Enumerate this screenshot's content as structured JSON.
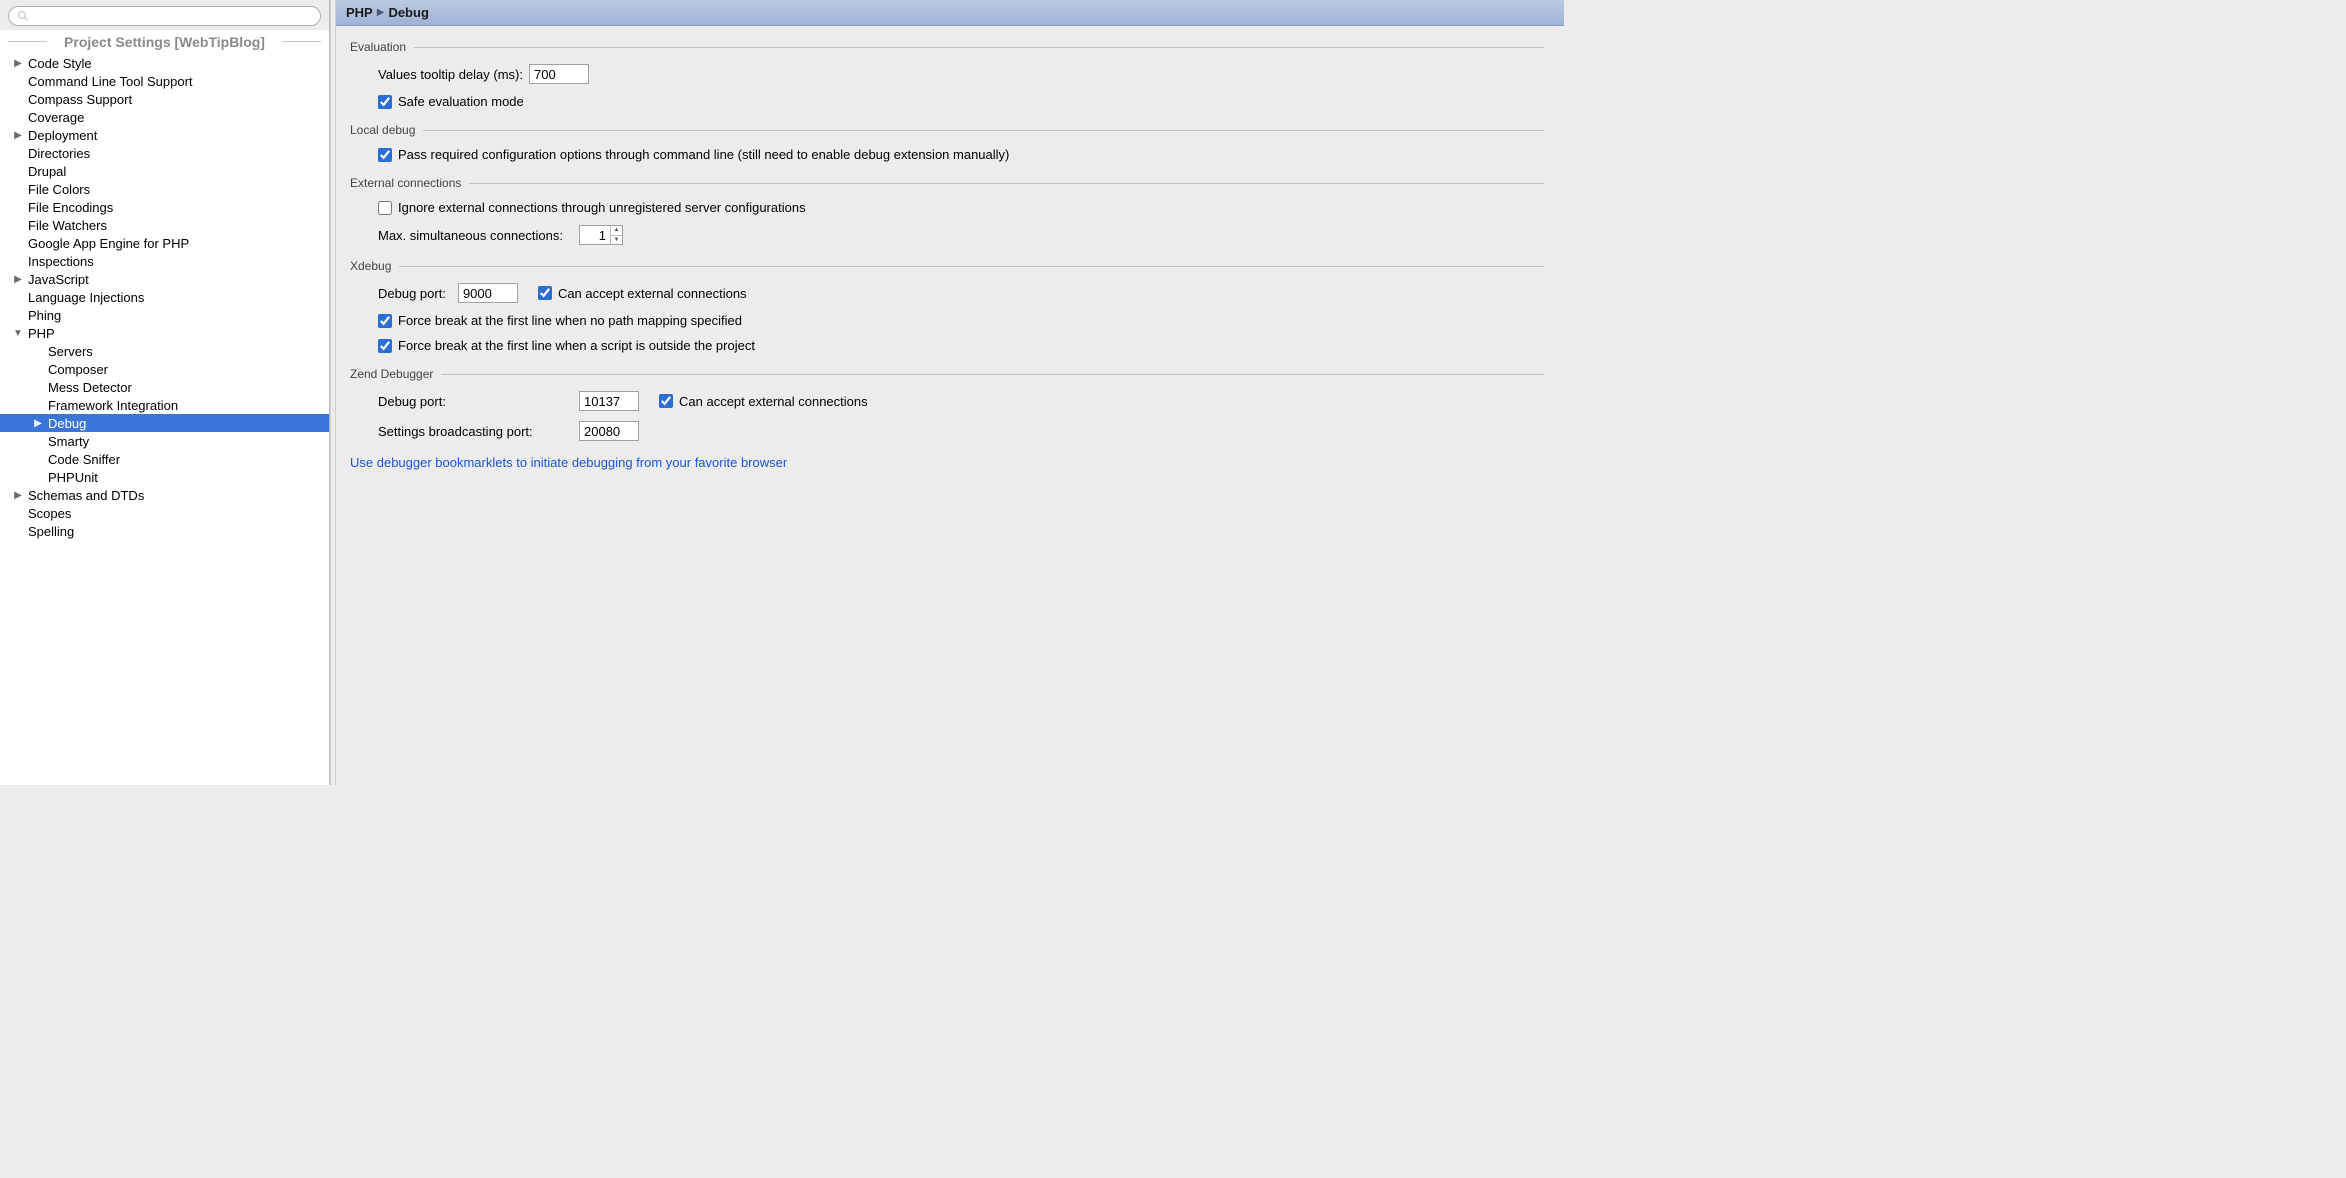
{
  "sidebar": {
    "sectionTitle": "Project Settings [WebTipBlog]",
    "searchPlaceholder": "",
    "items": [
      {
        "label": "Code Style",
        "arrow": "right",
        "level": 1
      },
      {
        "label": "Command Line Tool Support",
        "arrow": "none",
        "level": 1
      },
      {
        "label": "Compass Support",
        "arrow": "none",
        "level": 1
      },
      {
        "label": "Coverage",
        "arrow": "none",
        "level": 1
      },
      {
        "label": "Deployment",
        "arrow": "right",
        "level": 1
      },
      {
        "label": "Directories",
        "arrow": "none",
        "level": 1
      },
      {
        "label": "Drupal",
        "arrow": "none",
        "level": 1
      },
      {
        "label": "File Colors",
        "arrow": "none",
        "level": 1
      },
      {
        "label": "File Encodings",
        "arrow": "none",
        "level": 1
      },
      {
        "label": "File Watchers",
        "arrow": "none",
        "level": 1
      },
      {
        "label": "Google App Engine for PHP",
        "arrow": "none",
        "level": 1
      },
      {
        "label": "Inspections",
        "arrow": "none",
        "level": 1
      },
      {
        "label": "JavaScript",
        "arrow": "right",
        "level": 1
      },
      {
        "label": "Language Injections",
        "arrow": "none",
        "level": 1
      },
      {
        "label": "Phing",
        "arrow": "none",
        "level": 1
      },
      {
        "label": "PHP",
        "arrow": "down",
        "level": 1
      },
      {
        "label": "Servers",
        "arrow": "none",
        "level": 2
      },
      {
        "label": "Composer",
        "arrow": "none",
        "level": 2
      },
      {
        "label": "Mess Detector",
        "arrow": "none",
        "level": 2
      },
      {
        "label": "Framework Integration",
        "arrow": "none",
        "level": 2
      },
      {
        "label": "Debug",
        "arrow": "right",
        "level": 2,
        "selected": true
      },
      {
        "label": "Smarty",
        "arrow": "none",
        "level": 2
      },
      {
        "label": "Code Sniffer",
        "arrow": "none",
        "level": 2
      },
      {
        "label": "PHPUnit",
        "arrow": "none",
        "level": 2
      },
      {
        "label": "Schemas and DTDs",
        "arrow": "right",
        "level": 1
      },
      {
        "label": "Scopes",
        "arrow": "none",
        "level": 1
      },
      {
        "label": "Spelling",
        "arrow": "none",
        "level": 1
      }
    ]
  },
  "breadcrumb": {
    "root": "PHP",
    "current": "Debug"
  },
  "groups": {
    "evaluation": {
      "title": "Evaluation",
      "tooltipDelayLabel": "Values tooltip delay (ms):",
      "tooltipDelayValue": "700",
      "safeEvalLabel": "Safe evaluation mode",
      "safeEvalChecked": true
    },
    "localDebug": {
      "title": "Local debug",
      "passConfigLabel": "Pass required configuration options through command line (still need to enable debug extension manually)",
      "passConfigChecked": true
    },
    "externalConn": {
      "title": "External connections",
      "ignoreLabel": "Ignore external connections through unregistered server configurations",
      "ignoreChecked": false,
      "maxConnLabel": "Max. simultaneous connections:",
      "maxConnValue": "1"
    },
    "xdebug": {
      "title": "Xdebug",
      "portLabel": "Debug port:",
      "portValue": "9000",
      "acceptExtLabel": "Can accept external connections",
      "acceptExtChecked": true,
      "forceBreakNoPathLabel": "Force break at the first line when no path mapping specified",
      "forceBreakNoPathChecked": true,
      "forceBreakOutsideLabel": "Force break at the first line when a script is outside the project",
      "forceBreakOutsideChecked": true
    },
    "zend": {
      "title": "Zend Debugger",
      "portLabel": "Debug port:",
      "portValue": "10137",
      "acceptExtLabel": "Can accept external connections",
      "acceptExtChecked": true,
      "broadcastLabel": "Settings broadcasting port:",
      "broadcastValue": "20080"
    },
    "linkText": "Use debugger bookmarklets to initiate debugging from your favorite browser"
  }
}
